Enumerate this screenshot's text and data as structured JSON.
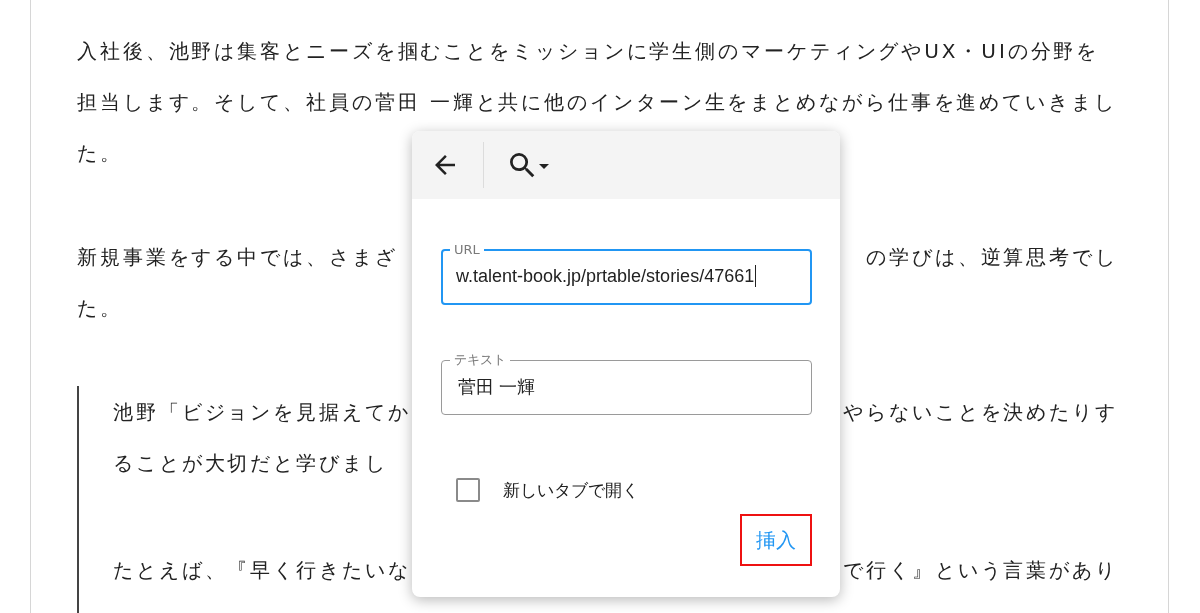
{
  "article": {
    "blocks": [
      {
        "kind": "paragraph",
        "lines": [
          [
            "入社後、池野は集客とニーズを掴むことをミッションに学生側のマーケティングやUX・UIの分野を"
          ],
          [
            "担当します。そして、社員の菅田 一輝と共に他のインターン生をまとめながら仕事を進めていきまし"
          ],
          [
            "た。"
          ]
        ]
      },
      {
        "kind": "paragraph",
        "lines": [
          [
            "新規事業をする中では、さまざ",
            "の学びは、逆算思考でし"
          ],
          [
            "た。"
          ]
        ]
      },
      {
        "kind": "quote",
        "paragraphs": [
          {
            "lines": [
              [
                "池野「ビジョンを見据えてか",
                "やらないことを決めたりす"
              ],
              [
                "ることが大切だと学びまし"
              ]
            ]
          },
          {
            "lines": [
              [
                "たとえば、『早く行きたいな",
                "で行く』という言葉があり"
              ]
            ]
          }
        ]
      }
    ]
  },
  "link_dialog": {
    "fields": [
      {
        "label": "URL",
        "value": "w.talent-book.jp/prtable/stories/47661",
        "focused": true
      },
      {
        "label": "テキスト",
        "value": "菅田 一輝",
        "focused": false
      }
    ],
    "new_tab_option": {
      "label": "新しいタブで開く",
      "checked": false
    },
    "insert_button": {
      "label": "挿入",
      "highlighted": true
    }
  }
}
